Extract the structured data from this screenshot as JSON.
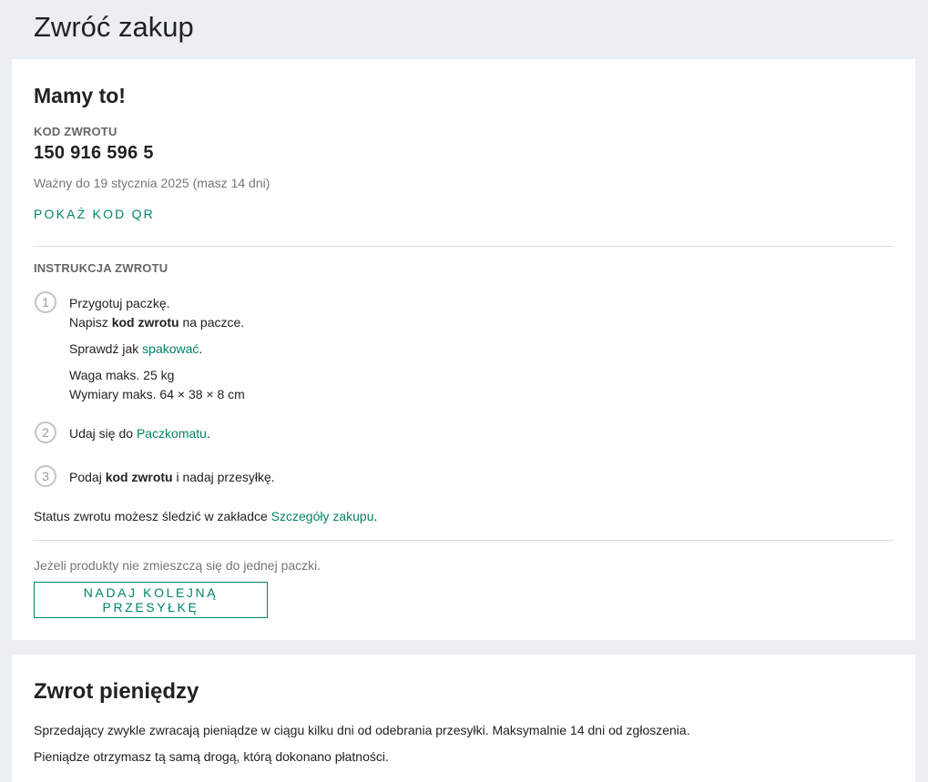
{
  "page": {
    "title": "Zwróć zakup"
  },
  "return_card": {
    "heading": "Mamy to!",
    "code_label": "KOD ZWROTU",
    "code_value": "150 916 596 5",
    "valid_until": "Ważny do 19 stycznia 2025 (masz 14 dni)",
    "show_qr_label": "POKAŻ KOD QR",
    "instructions_label": "INSTRUKCJA ZWROTU",
    "steps": [
      {
        "number": "1",
        "line1": "Przygotuj paczkę.",
        "line2_prefix": "Napisz ",
        "line2_bold": "kod zwrotu",
        "line2_suffix": " na paczce.",
        "check_prefix": "Sprawdź jak ",
        "check_link": "spakować",
        "check_suffix": ".",
        "weight": "Waga maks. 25 kg",
        "dimensions": "Wymiary maks. 64 × 38 × 8 cm"
      },
      {
        "number": "2",
        "prefix": "Udaj się do ",
        "link": "Paczkomatu",
        "suffix": "."
      },
      {
        "number": "3",
        "prefix": "Podaj ",
        "bold": "kod zwrotu",
        "suffix": " i nadaj przesyłkę."
      }
    ],
    "status_prefix": "Status zwrotu możesz śledzić w zakładce ",
    "status_link": "Szczegóły zakupu",
    "status_suffix": ".",
    "extra_note": "Jeżeli produkty nie zmieszczą się do jednej paczki.",
    "another_shipment_label": "NADAJ KOLEJNĄ PRZESYŁKĘ"
  },
  "refund_card": {
    "heading": "Zwrot pieniędzy",
    "text1": "Sprzedający zwykle zwracają pieniądze w ciągu kilku dni od odebrania przesyłki. Maksymalnie 14 dni od zgłoszenia.",
    "text2": "Pieniądze otrzymasz tą samą drogą, którą dokonano płatności."
  },
  "colors": {
    "accent": "#00836a",
    "background": "#eceff1",
    "card": "#ffffff"
  }
}
